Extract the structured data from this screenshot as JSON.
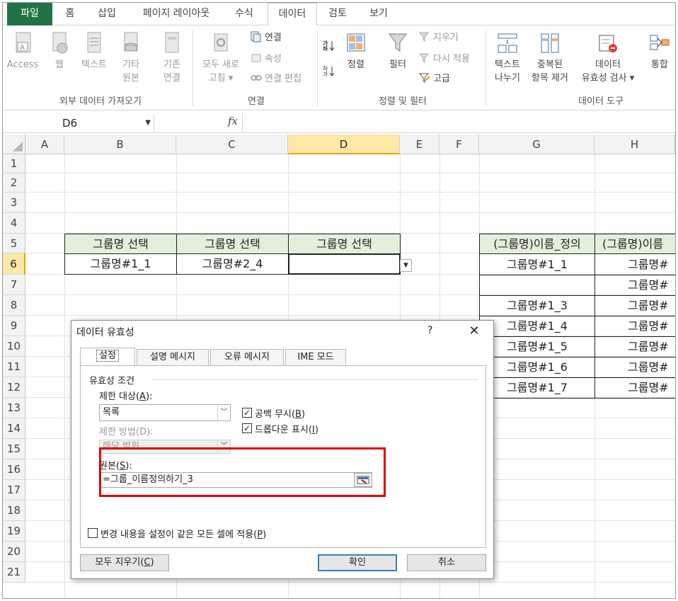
{
  "ribbon_tabs": [
    "파일",
    "홈",
    "삽입",
    "페이지 레이아웃",
    "수식",
    "데이터",
    "검토",
    "보기"
  ],
  "ribbon": {
    "access": "Access",
    "web": "웹",
    "text": "텍스트",
    "other_1": "기타",
    "other_2": "원본",
    "existing_1": "기존",
    "existing_2": "연결",
    "group_external": "외부 데이터 가져오기",
    "refresh_1": "모두 새로",
    "refresh_2": "고침",
    "connections": "연결",
    "properties": "속성",
    "edit_links": "연결 편집",
    "group_connections": "연결",
    "sort": "정렬",
    "filter": "필터",
    "clear": "지우기",
    "reapply": "다시 적용",
    "advanced": "고급",
    "group_sort": "정렬 및 필터",
    "text_to_col_1": "텍스트",
    "text_to_col_2": "나누기",
    "remove_dup_1": "중복된",
    "remove_dup_2": "항목 제거",
    "validation_1": "데이터",
    "validation_2": "유효성 검사",
    "consolidate": "통합",
    "group_tools": "데이터 도구"
  },
  "formula_bar": {
    "name_box": "D6",
    "fx": "fx"
  },
  "columns": [
    "A",
    "B",
    "C",
    "D",
    "E",
    "F",
    "G",
    "H"
  ],
  "rows": [
    "1",
    "2",
    "3",
    "4",
    "5",
    "6",
    "7",
    "8",
    "9",
    "10",
    "11",
    "12",
    "13",
    "14",
    "15",
    "16",
    "17",
    "18",
    "19",
    "20",
    "21"
  ],
  "cells": {
    "b5": "그룹명 선택",
    "c5": "그룹명 선택",
    "d5": "그룹명 선택",
    "b6": "그룹명#1_1",
    "c6": "그룹명#2_4",
    "g5": "(그룹명)이름_정의",
    "h5": "(그룹명)이름",
    "g_list": [
      "그룹명#1_1",
      "",
      "그룹명#1_3",
      "그룹명#1_4",
      "그룹명#1_5",
      "그룹명#1_6",
      "그룹명#1_7"
    ],
    "h_list": [
      "그룹명#",
      "그룹명#",
      "그룹명#",
      "그룹명#",
      "그룹명#",
      "그룹명#",
      "그룹명#"
    ]
  },
  "dialog": {
    "title": "데이터 유효성",
    "help": "?",
    "close": "✕",
    "tabs": [
      "설정",
      "설명 메시지",
      "오류 메시지",
      "IME 모드"
    ],
    "group_title": "유효성 조건",
    "allow_label": "제한 대상(",
    "allow_key": "A",
    "allow_suffix": "):",
    "allow_value": "목록",
    "ignore_blank_label": "공백 무시(",
    "ignore_blank_key": "B",
    "dropdown_label": "드롭다운 표시(",
    "dropdown_key": "I",
    "data_label": "제한 방법(D):",
    "data_value": "해당 범위",
    "source_label": "원본(",
    "source_key": "S",
    "source_suffix": "):",
    "source_value": "=그룹_이름정의하기_3",
    "apply_all_label": "변경 내용을 설정이 같은 모든 셀에 적용(",
    "apply_all_key": "P",
    "clear_all_label": "모두 지우기(",
    "clear_all_key": "C",
    "ok": "확인",
    "cancel": "취소",
    "checked_mark": "✓",
    "close_paren": ")"
  },
  "colors": {
    "excel_green": "#217346",
    "header_fill": "#e2efda",
    "selection": "#ffe7a8",
    "highlight_box": "#e00000"
  }
}
